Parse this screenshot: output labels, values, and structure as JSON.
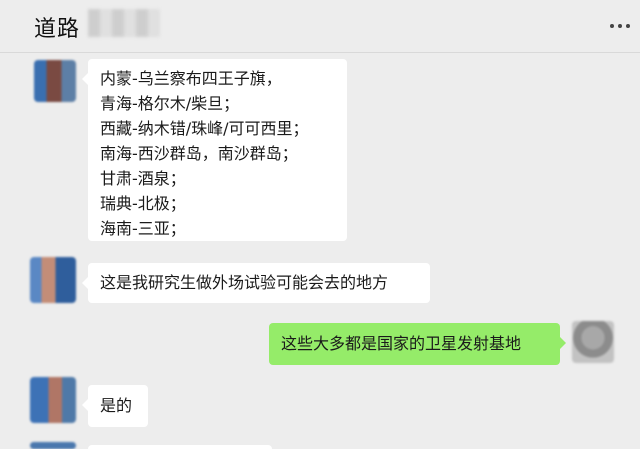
{
  "header": {
    "title": "道路",
    "more_icon": "ellipsis-icon"
  },
  "messages": [
    {
      "sender": "other",
      "lines": [
        "内蒙-乌兰察布四王子旗，",
        "青海-格尔木/柴旦；",
        "西藏-纳木错/珠峰/可可西里；",
        "南海-西沙群岛，南沙群岛；",
        "甘肃-酒泉；",
        "瑞典-北极；",
        "海南-三亚；"
      ]
    },
    {
      "sender": "other",
      "text": "这是我研究生做外场试验可能会去的地方"
    },
    {
      "sender": "me",
      "text": "这些大多都是国家的卫星发射基地"
    },
    {
      "sender": "other",
      "text": "是的"
    }
  ],
  "colors": {
    "background": "#ededed",
    "bubble_other": "#ffffff",
    "bubble_me": "#95ec69"
  }
}
